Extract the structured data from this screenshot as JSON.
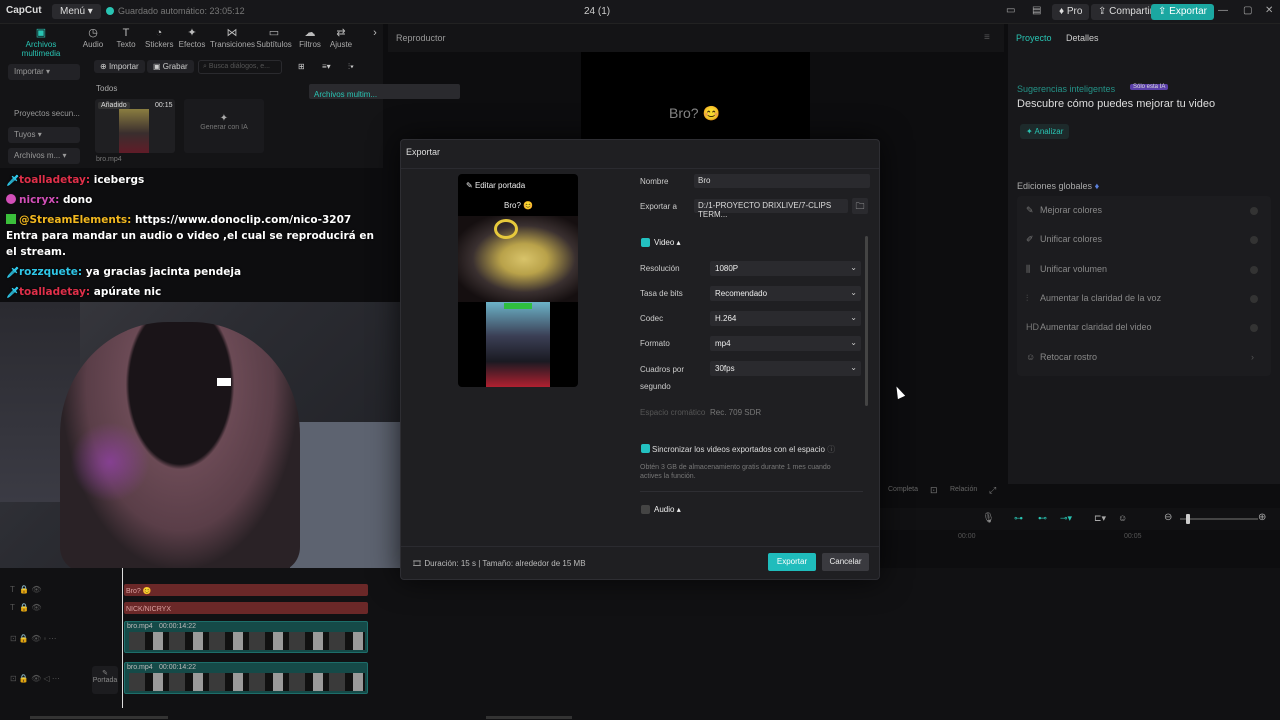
{
  "titlebar": {
    "logo": "CapCut",
    "menu": "Menú",
    "autosave": "Guardado automático: 23:05:12",
    "project_name": "24 (1)",
    "pro": "Pro",
    "share": "Compartir",
    "export": "Exportar"
  },
  "left": {
    "tools": [
      "Archivos multimedia",
      "Audio",
      "Texto",
      "Stickers",
      "Efectos",
      "Transiciones",
      "Subtítulos",
      "Filtros",
      "Ajuste"
    ],
    "sidebar": [
      "Importar",
      "Archivos multim...",
      "Proyectos secun...",
      "Tuyos",
      "Archivos m..."
    ],
    "import": "Importar",
    "record": "Grabar",
    "search_placeholder": "Busca diálogos, e...",
    "all": "Todos",
    "added": "Añadido",
    "duration": "00:15",
    "file_name": "bro.mp4",
    "ai_gen": "Generar con IA"
  },
  "chat": [
    {
      "user": "toalladetay:",
      "msg": "icebergs",
      "color": "red"
    },
    {
      "user": "nicryx:",
      "msg": "dono",
      "color": "pink"
    },
    {
      "user": "@StreamElements:",
      "msg": "https://www.donoclip.com/nico-3207 Entra para mandar un audio o video ,el cual se reproducirá en el stream.",
      "color": "yellow"
    },
    {
      "user": "rozzquete:",
      "msg": "ya gracias jacinta pendeja",
      "color": "cyan"
    },
    {
      "user": "toalladetay:",
      "msg": "apúrate nic",
      "color": "red"
    }
  ],
  "player": {
    "title": "Reproductor",
    "preview_text": "Bro? 😊",
    "complete": "Completa",
    "ratio": "Relación"
  },
  "right": {
    "tab_project": "Proyecto",
    "tab_details": "Detalles",
    "smart_title": "Sugerencias inteligentes",
    "smart_tag": "Sólo esta IA",
    "smart_desc": "Descubre cómo puedes mejorar tu video",
    "analyze": "Analizar",
    "global": "Ediciones globales",
    "items": [
      "Mejorar colores",
      "Unificar colores",
      "Unificar volumen",
      "Aumentar la claridad de la voz",
      "Aumentar claridad del video",
      "Retocar rostro"
    ]
  },
  "timeline": {
    "clip_text1": "Bro? 😊",
    "clip_text2": "NICK/NICRYX",
    "clip_video": "bro.mp4",
    "clip_time": "00:00:14:22",
    "cover": "Portada",
    "time1": "00:00",
    "time2": "00:05"
  },
  "dialog": {
    "title": "Exportar",
    "edit_cover": "Editar portada",
    "cover_caption": "Bro? 😊",
    "name_label": "Nombre",
    "name_value": "Bro",
    "export_to_label": "Exportar a",
    "export_to_value": "D:/1-PROYECTO DRIXLIVE/7-CLIPS TERM...",
    "video_label": "Video",
    "resolution_label": "Resolución",
    "resolution_value": "1080P",
    "bitrate_label": "Tasa de bits",
    "bitrate_value": "Recomendado",
    "codec_label": "Codec",
    "codec_value": "H.264",
    "format_label": "Formato",
    "format_value": "mp4",
    "fps_label": "Cuadros por",
    "fps_label2": "segundo",
    "fps_value": "30fps",
    "color_space_label": "Espacio cromático",
    "color_space_value": "Rec. 709 SDR",
    "sync_label": "Sincronizar los videos exportados con el espacio",
    "sync_desc": "Obtén 3 GB de almacenamiento gratis durante 1 mes cuando actives la función.",
    "audio_label": "Audio",
    "footer": "Duración: 15 s | Tamaño: alrededor de 15 MB",
    "export_btn": "Exportar",
    "cancel_btn": "Cancelar"
  },
  "colors": {
    "accent": "#1ba7a1",
    "checkbox": "#23c1c1",
    "dialog_bg": "#1f1f22"
  }
}
